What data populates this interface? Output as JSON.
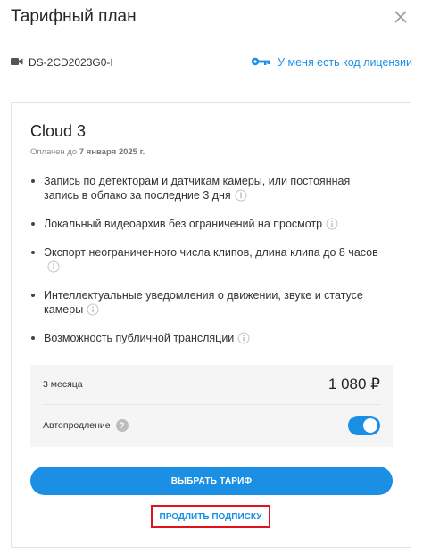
{
  "dialog": {
    "title": "Тарифный план",
    "close_icon": "close-icon"
  },
  "device": {
    "icon": "camera-icon",
    "name": "DS-2CD2023G0-I"
  },
  "license": {
    "icon": "key-icon",
    "label": "У меня есть код лицензии"
  },
  "plan": {
    "name": "Cloud 3",
    "paid_prefix": "Оплачен до ",
    "paid_date": "7 января 2025 г.",
    "features": [
      "Запись по детекторам и датчикам камеры, или постоянная запись в облако за последние 3 дня",
      "Локальный видеоархив без ограничений на просмотр",
      "Экспорт неограниченного числа клипов, длина клипа до 8 часов",
      "Интеллектуальные уведомления о движении, звуке и статусе камеры",
      "Возможность публичной трансляции"
    ]
  },
  "pricing": {
    "period": "3 месяца",
    "price": "1 080 ₽",
    "autorenew_label": "Автопродление",
    "autorenew_help": "?",
    "autorenew_on": true
  },
  "actions": {
    "choose_label": "ВЫБРАТЬ ТАРИФ",
    "extend_label": "ПРОДЛИТЬ ПОДПИСКУ"
  },
  "colors": {
    "accent": "#1a8fe3",
    "highlight": "#e0121e"
  }
}
